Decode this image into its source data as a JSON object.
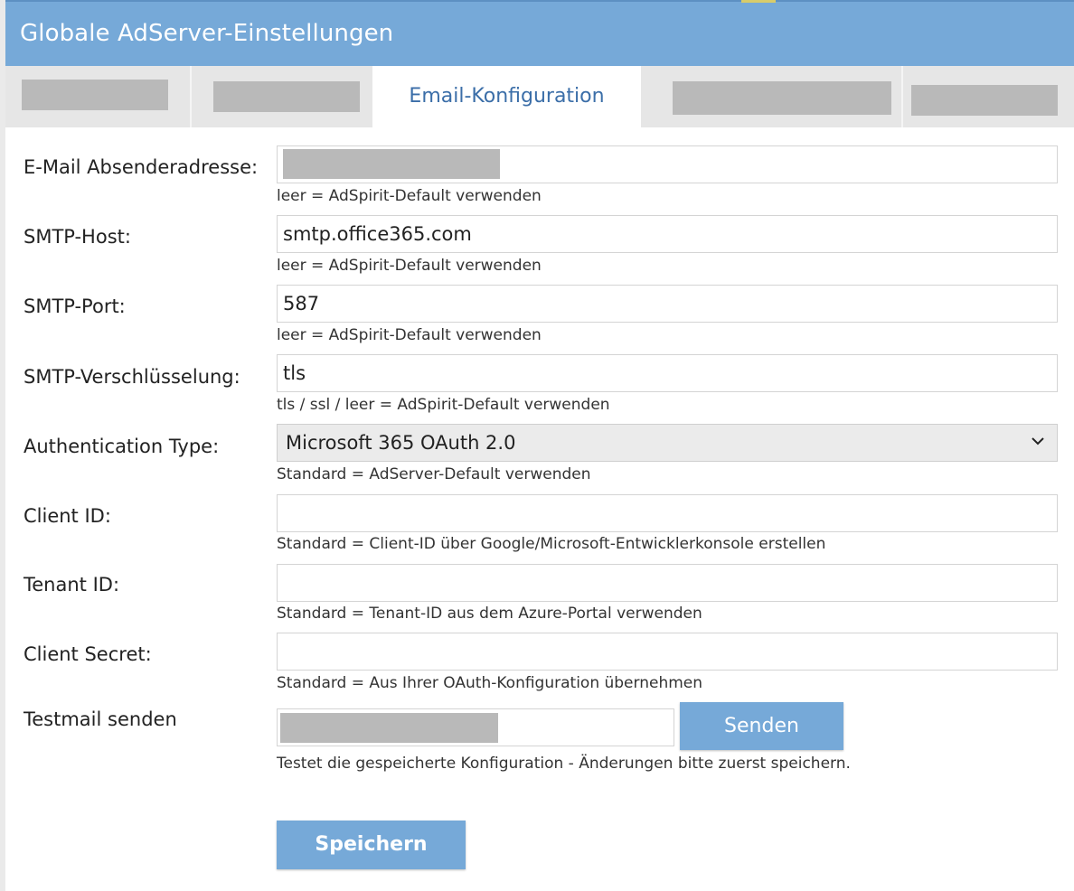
{
  "header": {
    "title": "Globale AdServer-Einstellungen"
  },
  "tabs": [
    {
      "label": "",
      "redacted": true
    },
    {
      "label": "",
      "redacted": true
    },
    {
      "label": "Email-Konfiguration",
      "redacted": false,
      "active": true
    },
    {
      "label": "",
      "redacted": true
    },
    {
      "label": "",
      "redacted": true
    }
  ],
  "form": {
    "sender_email": {
      "label": "E-Mail Absenderadresse:",
      "value": "",
      "redacted": true,
      "hint": "leer = AdSpirit-Default verwenden"
    },
    "smtp_host": {
      "label": "SMTP-Host:",
      "value": "smtp.office365.com",
      "hint": "leer = AdSpirit-Default verwenden"
    },
    "smtp_port": {
      "label": "SMTP-Port:",
      "value": "587",
      "hint": "leer = AdSpirit-Default verwenden"
    },
    "smtp_encryption": {
      "label": "SMTP-Verschlüsselung:",
      "value": "tls",
      "hint": "tls / ssl / leer = AdSpirit-Default verwenden"
    },
    "auth_type": {
      "label": "Authentication Type:",
      "selected": "Microsoft 365 OAuth 2.0",
      "hint": "Standard = AdServer-Default verwenden"
    },
    "client_id": {
      "label": "Client ID:",
      "value": "",
      "hint": "Standard = Client-ID über Google/Microsoft-Entwicklerkonsole erstellen"
    },
    "tenant_id": {
      "label": "Tenant ID:",
      "value": "",
      "hint": "Standard = Tenant-ID aus dem Azure-Portal verwenden"
    },
    "client_secret": {
      "label": "Client Secret:",
      "value": "",
      "hint": "Standard = Aus Ihrer OAuth-Konfiguration übernehmen"
    },
    "testmail": {
      "label": "Testmail senden",
      "value": "",
      "redacted": true,
      "button": "Senden",
      "hint": "Testet die gespeicherte Konfiguration - Änderungen bitte zuerst speichern."
    }
  },
  "save_button": "Speichern",
  "colors": {
    "accent": "#76a9d8",
    "tab_active_text": "#3b6ea8",
    "redaction": "#b9b9b9"
  },
  "icons": {
    "select_arrow": "chevron-down-icon"
  }
}
